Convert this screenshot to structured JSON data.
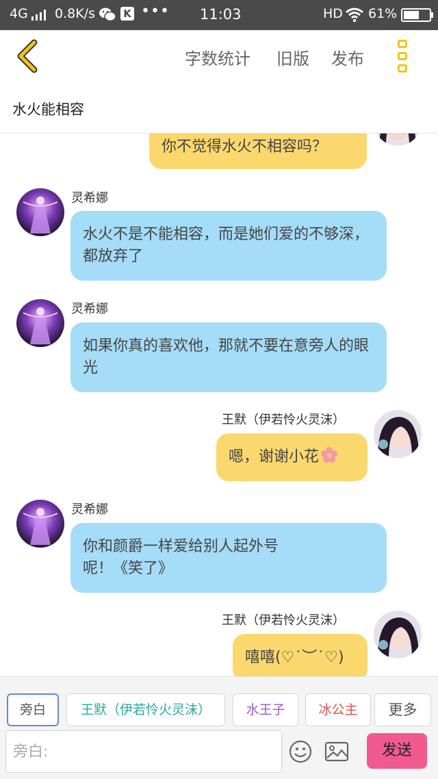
{
  "status_bar": {
    "network": "4G",
    "speed": "0.8K/s",
    "k_badge": "K",
    "more": "•••",
    "time": "11:03",
    "hd": "HD",
    "battery_percent": "61%",
    "battery_level": 0.61
  },
  "header": {
    "word_count": "字数统计",
    "old_version": "旧版",
    "publish": "发布"
  },
  "title": "水火能相容",
  "messages": [
    {
      "side": "right",
      "name": "",
      "text": "你不觉得水火不相容吗？"
    },
    {
      "side": "left",
      "name": "灵希娜",
      "text": "水火不是不能相容，而是她们爱的不够深，都放弃了"
    },
    {
      "side": "left",
      "name": "灵希娜",
      "text": "如果你真的喜欢他，那就不要在意旁人的眼光"
    },
    {
      "side": "right",
      "name": "王默（伊若怜火灵沫）",
      "text": "嗯，谢谢小花"
    },
    {
      "side": "left",
      "name": "灵希娜",
      "text": "你和颜爵一样爱给别人起外号呢！《笑了》"
    },
    {
      "side": "right",
      "name": "王默（伊若怜火灵沫）",
      "text": "嘻嘻(♡˙︶˙♡)"
    }
  ],
  "bottom": {
    "roles": [
      "旁白",
      "王默（伊若怜火灵沫）",
      "水王子",
      "冰公主",
      "更多"
    ],
    "input_placeholder": "旁白:",
    "send": "发送"
  },
  "colors": {
    "accent": "#f0c419",
    "left_bubble": "#a5dcf7",
    "right_bubble": "#fbd86d",
    "send_button": "#f05a8f"
  }
}
